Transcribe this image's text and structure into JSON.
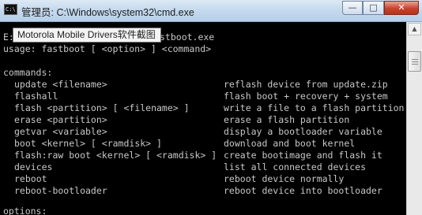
{
  "window": {
    "title": "管理员: C:\\Windows\\system32\\cmd.exe",
    "icon": "cmd-icon",
    "icon_text": "C:\\",
    "controls": {
      "minimize": "—",
      "maximize": "□",
      "close": "✕"
    }
  },
  "tooltip": {
    "text": "Motorola Mobile Drivers软件截图"
  },
  "console": {
    "prompt_line_start": "E:",
    "prompt_line_end": "stboot.exe",
    "usage": "usage: fastboot [ <option> ] <command>",
    "commands_header": "commands:",
    "commands": [
      {
        "cmd": "update <filename>",
        "desc": "reflash device from update.zip"
      },
      {
        "cmd": "flashall",
        "desc": "flash boot + recovery + system"
      },
      {
        "cmd": "flash <partition> [ <filename> ]",
        "desc": "write a file to a flash partition"
      },
      {
        "cmd": "erase <partition>",
        "desc": "erase a flash partition"
      },
      {
        "cmd": "getvar <variable>",
        "desc": "display a bootloader variable"
      },
      {
        "cmd": "boot <kernel> [ <ramdisk> ]",
        "desc": "download and boot kernel"
      },
      {
        "cmd": "flash:raw boot <kernel> [ <ramdisk> ]",
        "desc": "create bootimage and flash it"
      },
      {
        "cmd": "devices",
        "desc": "list all connected devices"
      },
      {
        "cmd": "reboot",
        "desc": "reboot device normally"
      },
      {
        "cmd": "reboot-bootloader",
        "desc": "reboot device into bootloader"
      }
    ],
    "options_header": "options:"
  }
}
